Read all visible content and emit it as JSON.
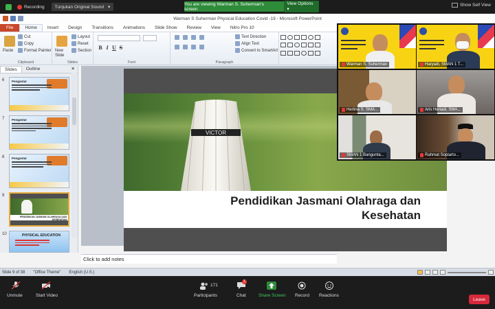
{
  "zoom": {
    "recording_label": "Recording",
    "tab_label": "Tunjukan Original Sound",
    "banner_text": "You are viewing Warman S. Suherman's screen",
    "view_options": "View Options",
    "self_view": "Show Self View",
    "bottom": {
      "unmute": "Unmute",
      "start_video": "Start Video",
      "participants": "Participants",
      "participants_count": "171",
      "chat": "Chat",
      "chat_badge": "1",
      "share_screen": "Share Screen",
      "record": "Record",
      "reactions": "Reactions",
      "leave": "Leave"
    },
    "tiles": [
      {
        "name": "Warman S. Suherman"
      },
      {
        "name": "Haryadi, SMAN 1 T..."
      },
      {
        "name": "Herlina S. SMA..."
      },
      {
        "name": "Aris Heriadi, SMA..."
      },
      {
        "name": "SMAN 1 Bangunta..."
      },
      {
        "name": "Rahmat Sopiarto..."
      }
    ],
    "accent_green": "#2e8b3a",
    "leave_color": "#d6293b"
  },
  "ppt": {
    "window_title": "Warman S Suherman Physical Education Covid -19  -  Microsoft PowerPoint",
    "tabs": [
      "File",
      "Home",
      "Insert",
      "Design",
      "Transitions",
      "Animations",
      "Slide Show",
      "Review",
      "View",
      "Nitro Pro 10"
    ],
    "ribbon": {
      "paste": "Paste",
      "cut": "Cut",
      "copy": "Copy",
      "format_painter": "Format Painter",
      "clipboard": "Clipboard",
      "new_slide": "New Slide",
      "layout": "Layout",
      "reset": "Reset",
      "section": "Section",
      "slides": "Slides",
      "font": "Font",
      "paragraph": "Paragraph",
      "text_direction": "Text Direction",
      "align_text": "Align Text",
      "convert_smartart": "Convert to SmartArt"
    },
    "panel_tabs": [
      "Slides",
      "Outline"
    ],
    "thumbnails": [
      {
        "num": "6",
        "title": "Pengantar"
      },
      {
        "num": "7",
        "title": "Pengantar"
      },
      {
        "num": "8",
        "title": "Pengantar"
      },
      {
        "num": "9",
        "title": "PENDIDIKAN JASMANI OLAHRAGA DAN KESEHATAN"
      },
      {
        "num": "10",
        "title": "PHYSICAL EDUCATION"
      }
    ],
    "slide_title_line1": "Pendidikan Jasmani Olahraga dan",
    "slide_title_line2": "Kesehatan",
    "shuttle_brand": "VICTOR",
    "notes_placeholder": "Click to add notes",
    "status": {
      "slide": "Slide 9 of 38",
      "theme": "\"Office Theme\"",
      "language": "English (U.S.)"
    }
  }
}
